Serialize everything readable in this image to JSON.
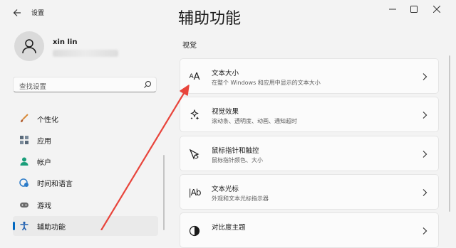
{
  "app": {
    "title": "设置"
  },
  "user": {
    "name": "xin lin"
  },
  "search": {
    "placeholder": "查找设置"
  },
  "nav": {
    "items": [
      {
        "label": "个性化",
        "icon": "brush-icon"
      },
      {
        "label": "应用",
        "icon": "apps-icon"
      },
      {
        "label": "帐户",
        "icon": "account-icon"
      },
      {
        "label": "时间和语言",
        "icon": "globe-clock-icon"
      },
      {
        "label": "游戏",
        "icon": "gamepad-icon"
      },
      {
        "label": "辅助功能",
        "icon": "accessibility-icon",
        "selected": true
      }
    ]
  },
  "main": {
    "title": "辅助功能",
    "section": "视觉",
    "cards": [
      {
        "title": "文本大小",
        "desc": "在整个 Windows 和应用中显示的文本大小",
        "icon": "text-size-icon"
      },
      {
        "title": "视觉效果",
        "desc": "滚动条、透明度、动画、通知超时",
        "icon": "visual-effects-icon"
      },
      {
        "title": "鼠标指针和触控",
        "desc": "鼠标指针颜色、大小",
        "icon": "mouse-pointer-icon"
      },
      {
        "title": "文本光标",
        "desc": "外观和文本光标指示器",
        "icon": "text-cursor-icon"
      },
      {
        "title": "对比度主题",
        "desc": "",
        "icon": "contrast-icon"
      }
    ]
  },
  "colors": {
    "accent": "#0067c0",
    "annotation": "#e8453c"
  }
}
